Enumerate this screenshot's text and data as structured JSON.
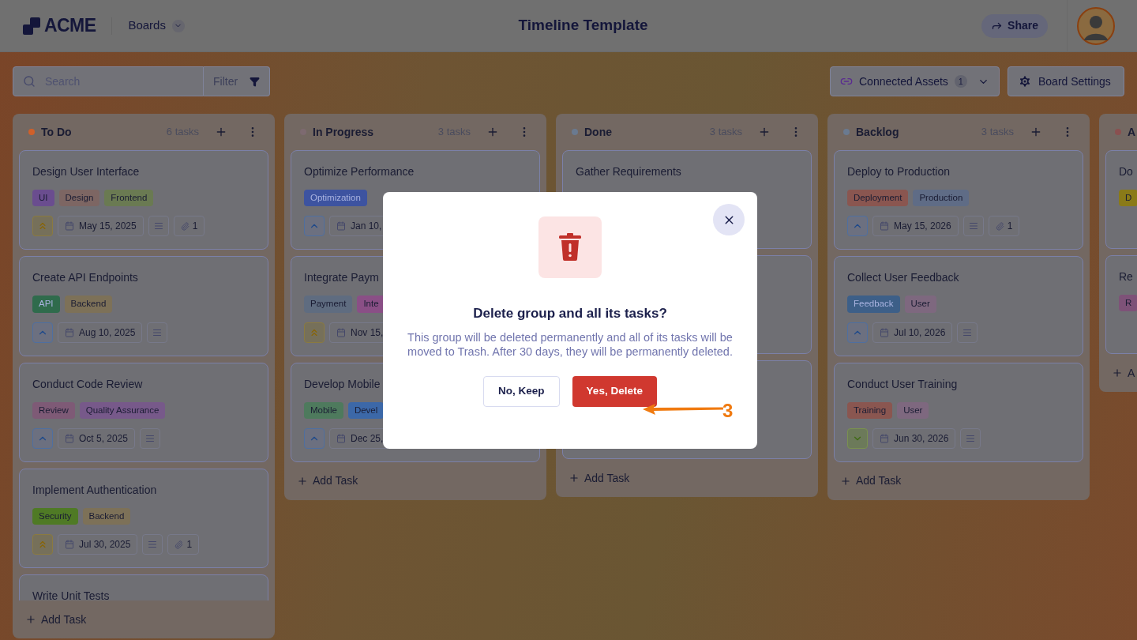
{
  "header": {
    "logo": "ACME",
    "nav": "Boards",
    "title": "Timeline Template",
    "share": "Share"
  },
  "toolbar": {
    "search": {
      "placeholder": "Search"
    },
    "filter": "Filter",
    "connected_assets": {
      "label": "Connected Assets",
      "count": "1"
    },
    "board_settings": "Board Settings"
  },
  "columns": [
    {
      "name": "To Do",
      "color": "#d0602a",
      "count": "6 tasks",
      "add_task": "Add Task",
      "tasks": [
        {
          "kind": "card",
          "title": "Design User Interface",
          "tags": [
            {
              "label": "UI",
              "color": "#6a4d8f"
            },
            {
              "label": "Design",
              "color": "#7d6663"
            },
            {
              "label": "Frontend",
              "color": "#6a7a52"
            }
          ],
          "priority": {
            "kind": "high"
          },
          "description": true,
          "date": "May 15, 2025",
          "attachments": "1"
        },
        {
          "kind": "card",
          "title": "Create API Endpoints",
          "tags": [
            {
              "label": "API",
              "color": "#2f6b4c"
            },
            {
              "label": "Backend",
              "color": "#7d7158"
            }
          ],
          "priority": {
            "kind": "medium"
          },
          "description": true,
          "date": "Aug 10, 2025"
        },
        {
          "kind": "card",
          "title": "Conduct Code Review",
          "tags": [
            {
              "label": "Review",
              "color": "#7e5a76"
            },
            {
              "label": "Quality Assurance",
              "color": "#77598a"
            }
          ],
          "priority": {
            "kind": "medium"
          },
          "description": true,
          "date": "Oct 5, 2025"
        },
        {
          "kind": "card",
          "title": "Implement Authentication",
          "tags": [
            {
              "label": "Security",
              "color": "#4f7a25"
            },
            {
              "label": "Backend",
              "color": "#7d7158"
            }
          ],
          "priority": {
            "kind": "high"
          },
          "description": true,
          "date": "Jul 30, 2025",
          "attachments": "1"
        },
        {
          "kind": "card",
          "title": "Write Unit Tests"
        }
      ]
    },
    {
      "name": "In Progress",
      "color": "#7d6a70",
      "count": "3 tasks",
      "add_task": "Add Task",
      "tasks": [
        {
          "kind": "card",
          "title": "Optimize Performance",
          "tags": [
            {
              "label": "Optimization",
              "color": "#3d53a0"
            }
          ],
          "priority": {
            "kind": "medium"
          },
          "date": "Jan 10,"
        },
        {
          "kind": "card",
          "title": "Integrate Paym",
          "tags": [
            {
              "label": "Payment",
              "color": "#5f6c80"
            },
            {
              "label": "Inte",
              "color": "#8a4f86"
            }
          ],
          "priority": {
            "kind": "high"
          },
          "date": "Nov 15,"
        },
        {
          "kind": "card",
          "title": "Develop Mobile",
          "tags": [
            {
              "label": "Mobile",
              "color": "#4e7a5d"
            },
            {
              "label": "Devel",
              "color": "#3c68a8"
            }
          ],
          "priority": {
            "kind": "medium"
          },
          "date": "Dec 25,"
        }
      ]
    },
    {
      "name": "Done",
      "color": "#6a7a90",
      "count": "3 tasks",
      "add_task": "Add Task",
      "tasks": [
        {
          "kind": "card",
          "title": "Gather Requirements"
        },
        {
          "kind": "covered"
        },
        {
          "kind": "covered"
        }
      ]
    },
    {
      "name": "Backlog",
      "color": "#6a7a90",
      "count": "3 tasks",
      "add_task": "Add Task",
      "tasks": [
        {
          "kind": "card",
          "title": "Deploy to Production",
          "tags": [
            {
              "label": "Deployment",
              "color": "#8a5650"
            },
            {
              "label": "Production",
              "color": "#5f6c86"
            }
          ],
          "priority": {
            "kind": "medium"
          },
          "description": true,
          "date": "May 15, 2026",
          "attachments": "1"
        },
        {
          "kind": "card",
          "title": "Collect User Feedback",
          "tags": [
            {
              "label": "Feedback",
              "color": "#3d5f88"
            },
            {
              "label": "User",
              "color": "#7e687f"
            }
          ],
          "priority": {
            "kind": "medium"
          },
          "description": true,
          "date": "Jul 10, 2026"
        },
        {
          "kind": "card",
          "title": "Conduct User Training",
          "tags": [
            {
              "label": "Training",
              "color": "#8a5650"
            },
            {
              "label": "User",
              "color": "#7e687f"
            }
          ],
          "priority": {
            "kind": "low"
          },
          "description": true,
          "date": "Jun 30, 2026"
        }
      ]
    },
    {
      "name": "A",
      "color": "#8a5050",
      "add_task": "A",
      "tasks": [
        {
          "kind": "card",
          "title": "Do",
          "tags": [
            {
              "label": "D",
              "color": "#8a7a18"
            }
          ]
        },
        {
          "kind": "card",
          "title": "Re",
          "tags": [
            {
              "label": "R",
              "color": "#7e5278"
            }
          ]
        }
      ]
    }
  ],
  "dialog": {
    "title": "Delete group and all its tasks?",
    "message": "This group will be deleted permanently and all of its tasks will be moved to Trash. After 30 days, they will be permanently deleted.",
    "buttons": [
      {
        "label": "No, Keep",
        "kind": "secondary"
      },
      {
        "label": "Yes, Delete",
        "kind": "danger"
      }
    ]
  },
  "annotation": {
    "label": "3"
  }
}
